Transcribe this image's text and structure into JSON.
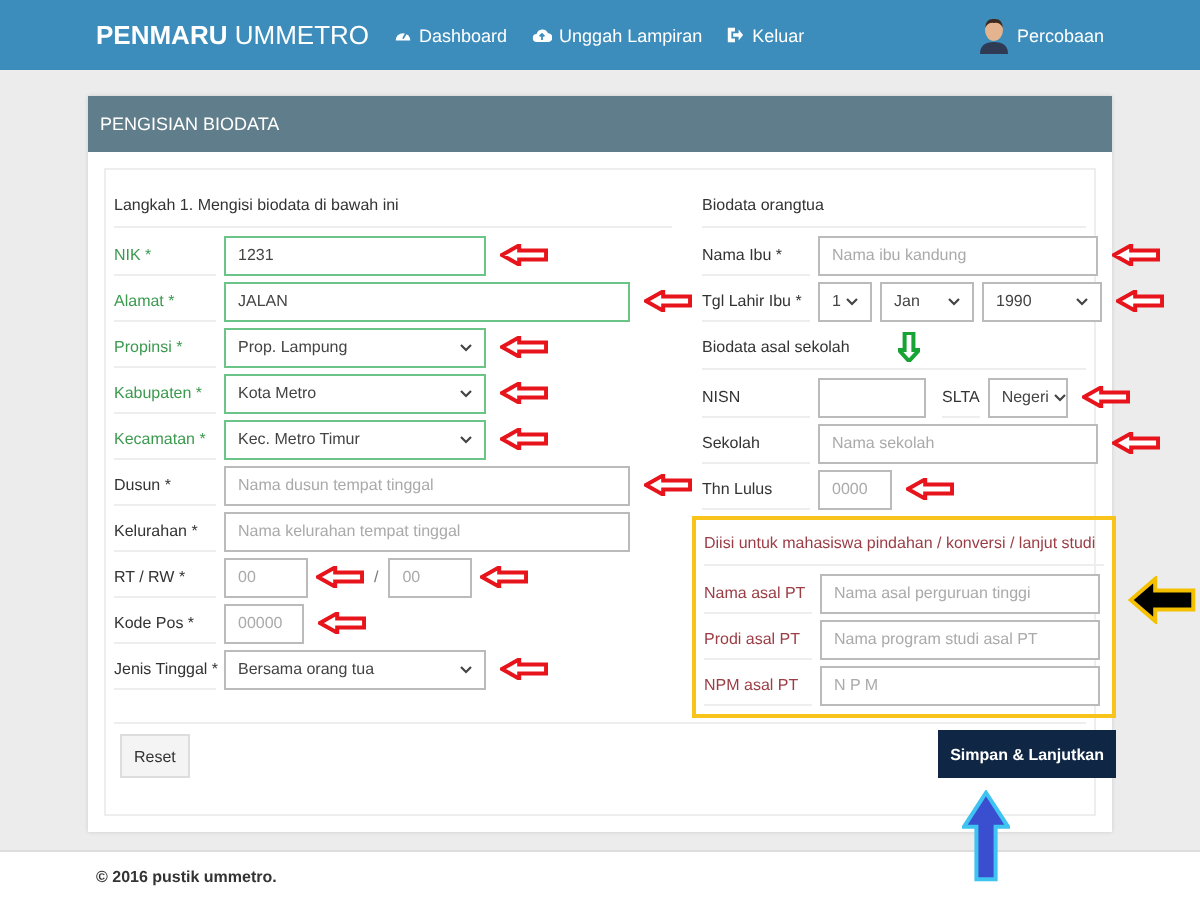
{
  "navbar": {
    "brand_bold": "PENMARU",
    "brand_rest": "UMMETRO",
    "links": [
      {
        "label": "Dashboard"
      },
      {
        "label": "Unggah Lampiran"
      },
      {
        "label": "Keluar"
      }
    ],
    "user": "Percobaan"
  },
  "panel": {
    "title": "PENGISIAN BIODATA",
    "left": {
      "heading": "Langkah 1. Mengisi biodata di bawah ini",
      "rows": [
        {
          "label": "NIK *",
          "kind": "text",
          "value": "1231",
          "valid": true,
          "arrow": true
        },
        {
          "label": "Alamat *",
          "kind": "text",
          "value": "JALAN",
          "valid": true,
          "arrow": true
        },
        {
          "label": "Propinsi *",
          "kind": "select",
          "value": "Prop. Lampung",
          "valid": true,
          "arrow": true
        },
        {
          "label": "Kabupaten *",
          "kind": "select",
          "value": "Kota Metro",
          "valid": true,
          "arrow": true
        },
        {
          "label": "Kecamatan *",
          "kind": "select",
          "value": "Kec. Metro Timur",
          "valid": true,
          "arrow": true
        },
        {
          "label": "Dusun *",
          "kind": "text",
          "placeholder": "Nama dusun tempat tinggal",
          "valid": false,
          "arrow": true
        },
        {
          "label": "Kelurahan *",
          "kind": "text",
          "placeholder": "Nama kelurahan tempat tinggal",
          "valid": false,
          "arrow": false
        },
        {
          "label": "RT / RW *",
          "kind": "pair",
          "separator": "/",
          "valid": false,
          "inputs": [
            {
              "placeholder": "00",
              "arrow": true
            },
            {
              "placeholder": "00",
              "arrow": true
            }
          ]
        },
        {
          "label": "Kode Pos *",
          "kind": "text",
          "placeholder": "00000",
          "valid": false,
          "arrow": true
        },
        {
          "label": "Jenis Tinggal *",
          "kind": "select",
          "value": "Bersama orang tua",
          "valid": false,
          "arrow": true
        }
      ]
    },
    "right": {
      "heading": "Biodata orangtua",
      "rows": [
        {
          "label": "Nama Ibu *",
          "kind": "text",
          "placeholder": "Nama ibu kandung",
          "valid": false,
          "arrow": true
        },
        {
          "label": "Tgl Lahir Ibu *",
          "kind": "date",
          "values": [
            "1",
            "Jan",
            "1990"
          ],
          "valid": false,
          "arrow": true
        }
      ],
      "school_heading": "Biodata asal sekolah",
      "school_rows": [
        {
          "label": "NISN",
          "kind": "nisn",
          "value_label": "SLTA",
          "select": "Negeri",
          "valid": false,
          "arrow": true
        },
        {
          "label": "Sekolah",
          "kind": "text",
          "placeholder": "Nama sekolah",
          "valid": false,
          "arrow": true
        },
        {
          "label": "Thn Lulus",
          "kind": "text",
          "placeholder": "0000",
          "valid": false,
          "arrow": true
        }
      ],
      "transfer": {
        "heading": "Diisi untuk mahasiswa pindahan / konversi / lanjut studi",
        "rows": [
          {
            "label": "Nama asal PT",
            "kind": "text",
            "placeholder": "Nama asal perguruan tinggi",
            "valid": false,
            "arrow": false
          },
          {
            "label": "Prodi asal PT",
            "kind": "text",
            "placeholder": "Nama program studi asal PT",
            "valid": false,
            "arrow": false
          },
          {
            "label": "NPM asal PT",
            "kind": "text",
            "placeholder": "N P M",
            "valid": false,
            "arrow": false
          }
        ]
      }
    },
    "reset": "Reset",
    "submit": "Simpan & Lanjutkan"
  },
  "footer": "© 2016 pustik ummetro."
}
